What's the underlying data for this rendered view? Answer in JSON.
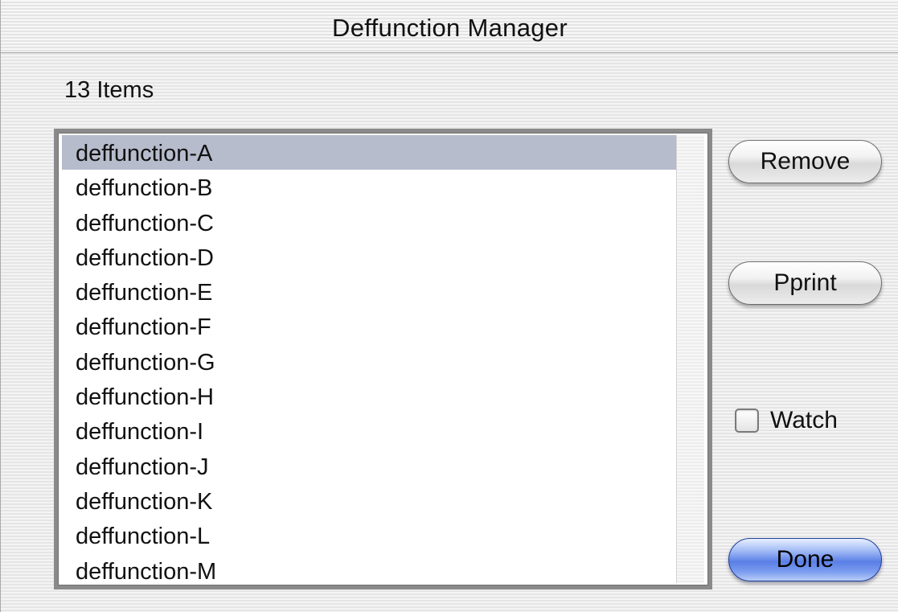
{
  "window": {
    "title": "Deffunction Manager"
  },
  "item_count": "13 Items",
  "list": {
    "selected_index": 0,
    "items": [
      {
        "label": "deffunction-A"
      },
      {
        "label": "deffunction-B"
      },
      {
        "label": "deffunction-C"
      },
      {
        "label": "deffunction-D"
      },
      {
        "label": "deffunction-E"
      },
      {
        "label": "deffunction-F"
      },
      {
        "label": "deffunction-G"
      },
      {
        "label": "deffunction-H"
      },
      {
        "label": "deffunction-I"
      },
      {
        "label": "deffunction-J"
      },
      {
        "label": "deffunction-K"
      },
      {
        "label": "deffunction-L"
      },
      {
        "label": "deffunction-M"
      }
    ]
  },
  "buttons": {
    "remove": "Remove",
    "pprint": "Pprint",
    "done": "Done"
  },
  "watch": {
    "label": "Watch",
    "checked": false
  },
  "colors": {
    "selection": "#b7bccc",
    "default_button": "#5a7fe6"
  }
}
